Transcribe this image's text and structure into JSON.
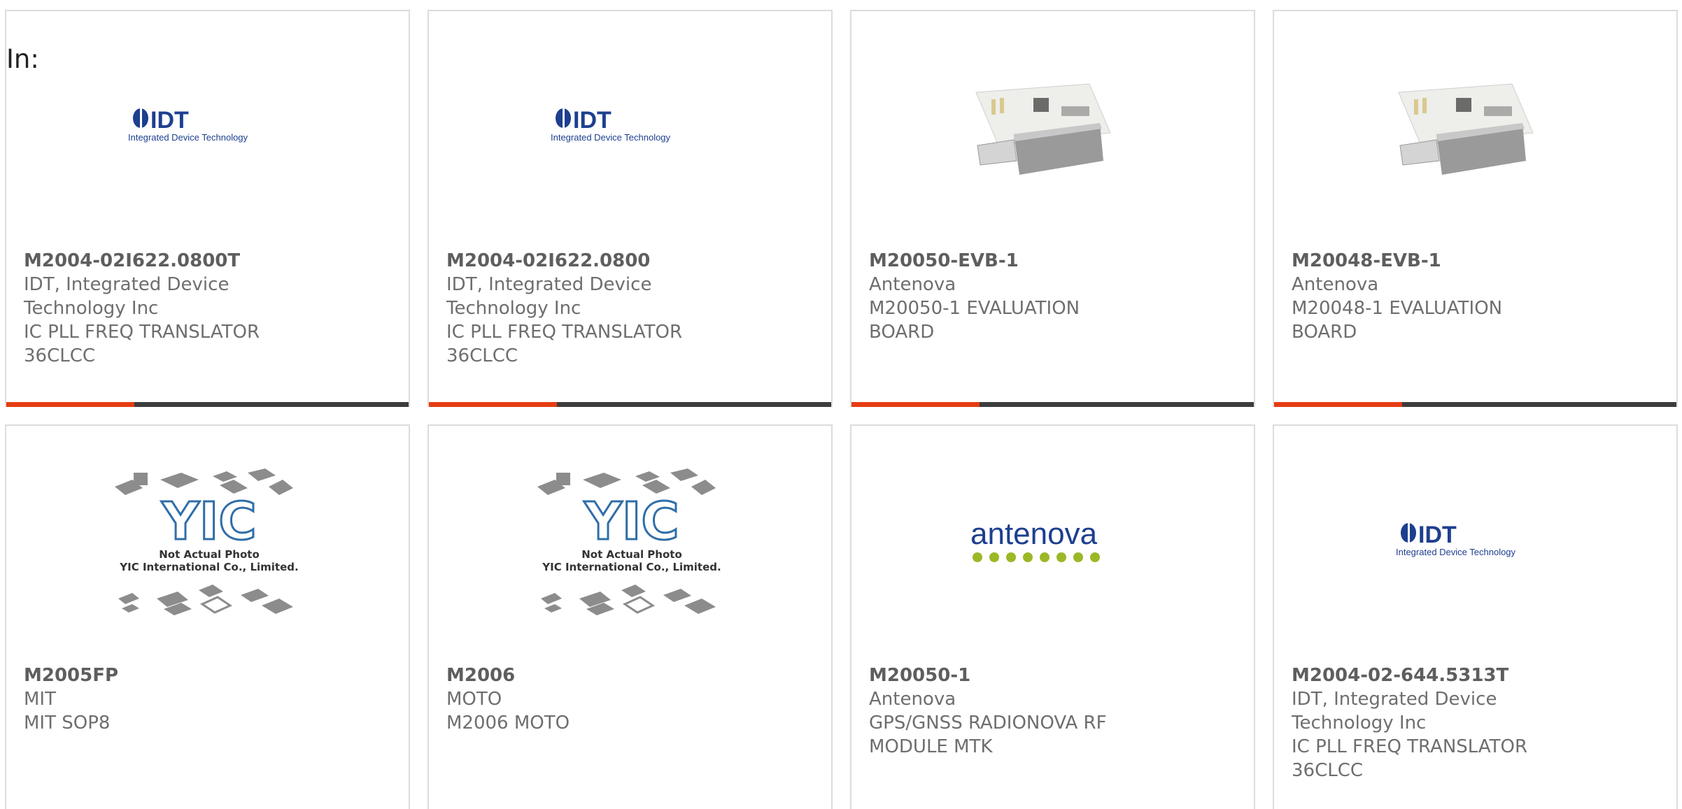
{
  "filter": {
    "label": "In:"
  },
  "cards": [
    {
      "part": "M2004-02I622.0800T",
      "maker": "IDT, Integrated Device Technology Inc",
      "desc": "IC PLL FREQ TRANSLATOR 36CLCC",
      "image": "idt-logo",
      "logo_text": {
        "mark": "IDT",
        "sub": "Integrated Device Technology"
      }
    },
    {
      "part": "M2004-02I622.0800",
      "maker": "IDT, Integrated Device Technology Inc",
      "desc": "IC PLL FREQ TRANSLATOR 36CLCC",
      "image": "idt-logo",
      "logo_text": {
        "mark": "IDT",
        "sub": "Integrated Device Technology"
      }
    },
    {
      "part": "M20050-EVB-1",
      "maker": "Antenova",
      "desc": "M20050-1 EVALUATION BOARD",
      "image": "usb-eval-board-photo"
    },
    {
      "part": "M20048-EVB-1",
      "maker": "Antenova",
      "desc": "M20048-1 EVALUATION BOARD",
      "image": "usb-eval-board-photo"
    },
    {
      "part": "M2005FP",
      "maker": "MIT",
      "desc": "MIT SOP8",
      "image": "yic-placeholder",
      "logo_text": {
        "line1": "Not Actual Photo",
        "line2": "YIC International Co., Limited."
      }
    },
    {
      "part": "M2006",
      "maker": "MOTO",
      "desc": "M2006 MOTO",
      "image": "yic-placeholder",
      "logo_text": {
        "line1": "Not Actual Photo",
        "line2": "YIC International Co., Limited."
      }
    },
    {
      "part": "M20050-1",
      "maker": "Antenova",
      "desc": "GPS/GNSS RADIONOVA RF MODULE MTK",
      "image": "antenova-logo",
      "logo_text": {
        "mark": "antenova"
      }
    },
    {
      "part": "M2004-02-644.5313T",
      "maker": "IDT, Integrated Device Technology Inc",
      "desc": "IC PLL FREQ TRANSLATOR 36CLCC",
      "image": "idt-logo",
      "logo_text": {
        "mark": "IDT",
        "sub": "Integrated Device Technology"
      }
    }
  ],
  "colors": {
    "accent": "#e63c12",
    "bar": "#3d3d3d",
    "border": "#dcdcdc",
    "text": "#6e6e6e",
    "idt_blue": "#1d3f8f",
    "antenova_green": "#9bb826"
  }
}
